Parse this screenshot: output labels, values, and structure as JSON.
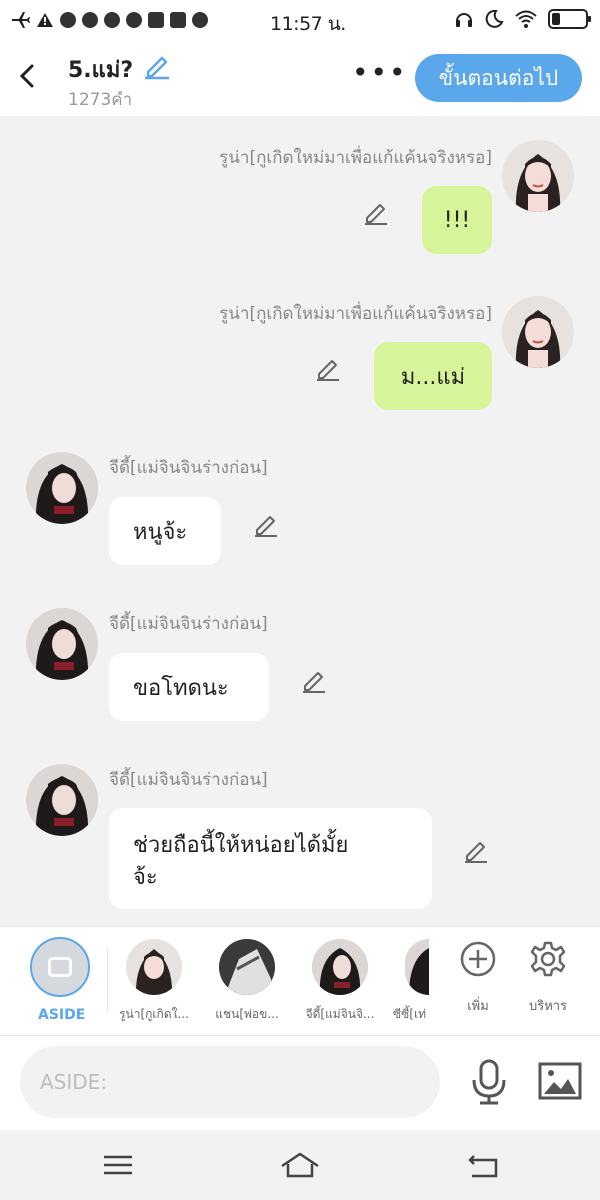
{
  "status_bar": {
    "time": "11:57 น."
  },
  "header": {
    "title": "5.แม่?",
    "word_count": "1273คำ",
    "more_label": "•••",
    "next_button": "ขั้นตอนต่อไป"
  },
  "messages": [
    {
      "side": "right",
      "sender": "รูน่า[กูเกิดใหม่มาเพื่อแก้แค้นจริงหรอ]",
      "text": "!!!"
    },
    {
      "side": "right",
      "sender": "รูน่า[กูเกิดใหม่มาเพื่อแก้แค้นจริงหรอ]",
      "text": "ม...แม่"
    },
    {
      "side": "left",
      "sender": "จีดี้[แม่จินจินร่างก่อน]",
      "text": "หนูจ้ะ"
    },
    {
      "side": "left",
      "sender": "จีดี้[แม่จินจินร่างก่อน]",
      "text": "ขอโทดนะ"
    },
    {
      "side": "left",
      "sender": "จีดี้[แม่จินจินร่างก่อน]",
      "text": "ช่วยถือนี้ให้หน่อยได้มั้ย",
      "text2": "จ้ะ"
    }
  ],
  "tray": {
    "aside_label": "ASIDE",
    "characters": [
      {
        "name": "รูน่า[กูเกิดใ..."
      },
      {
        "name": "แชน[พ่อข..."
      },
      {
        "name": "จีดี้[แม่จินจิ..."
      },
      {
        "name": "ซีซี้[เท่"
      }
    ],
    "add_label": "เพิ่ม",
    "manage_label": "บริหาร"
  },
  "input": {
    "placeholder": "ASIDE:"
  },
  "colors": {
    "accent": "#5aa7ec",
    "right_bubble": "#d6f59a",
    "left_bubble": "#ffffff",
    "background": "#f2f2f2"
  }
}
